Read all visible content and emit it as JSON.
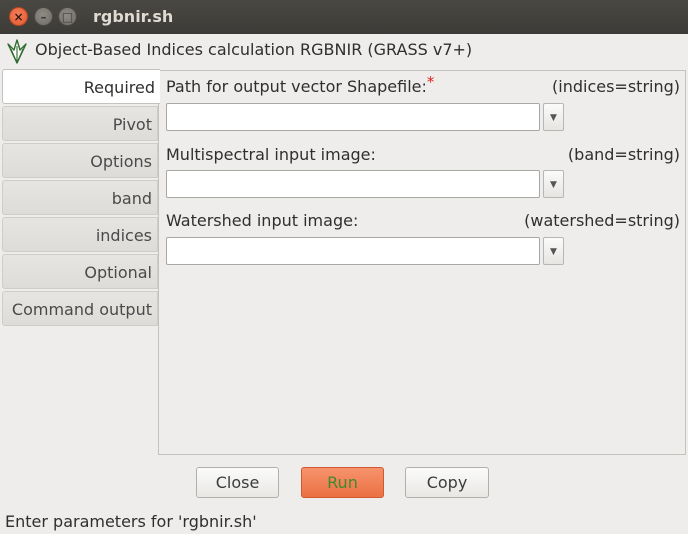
{
  "window": {
    "title": "rgbnir.sh",
    "close_glyph": "×",
    "min_glyph": "–",
    "max_glyph": "□"
  },
  "header": {
    "title": "Object-Based Indices calculation RGBNIR (GRASS v7+)",
    "icon": "grass-module-icon"
  },
  "tabs": [
    {
      "label": "Required",
      "active": true
    },
    {
      "label": "Pivot",
      "active": false
    },
    {
      "label": "Options",
      "active": false
    },
    {
      "label": "band",
      "active": false
    },
    {
      "label": "indices",
      "active": false
    },
    {
      "label": "Optional",
      "active": false
    },
    {
      "label": "Command output",
      "active": false
    }
  ],
  "fields": [
    {
      "label": "Path for output vector Shapefile:",
      "required_mark": "*",
      "key": "(indices=string)",
      "value": ""
    },
    {
      "label": "Multispectral input image:",
      "key": "(band=string)",
      "value": ""
    },
    {
      "label": "Watershed input image:",
      "key": "(watershed=string)",
      "value": ""
    }
  ],
  "buttons": {
    "close": "Close",
    "run": "Run",
    "copy": "Copy"
  },
  "status": "Enter parameters for 'rgbnir.sh'",
  "colors": {
    "run_button": "#ec7044",
    "required_mark": "#e02020",
    "titlebar": "#3d3b37"
  }
}
